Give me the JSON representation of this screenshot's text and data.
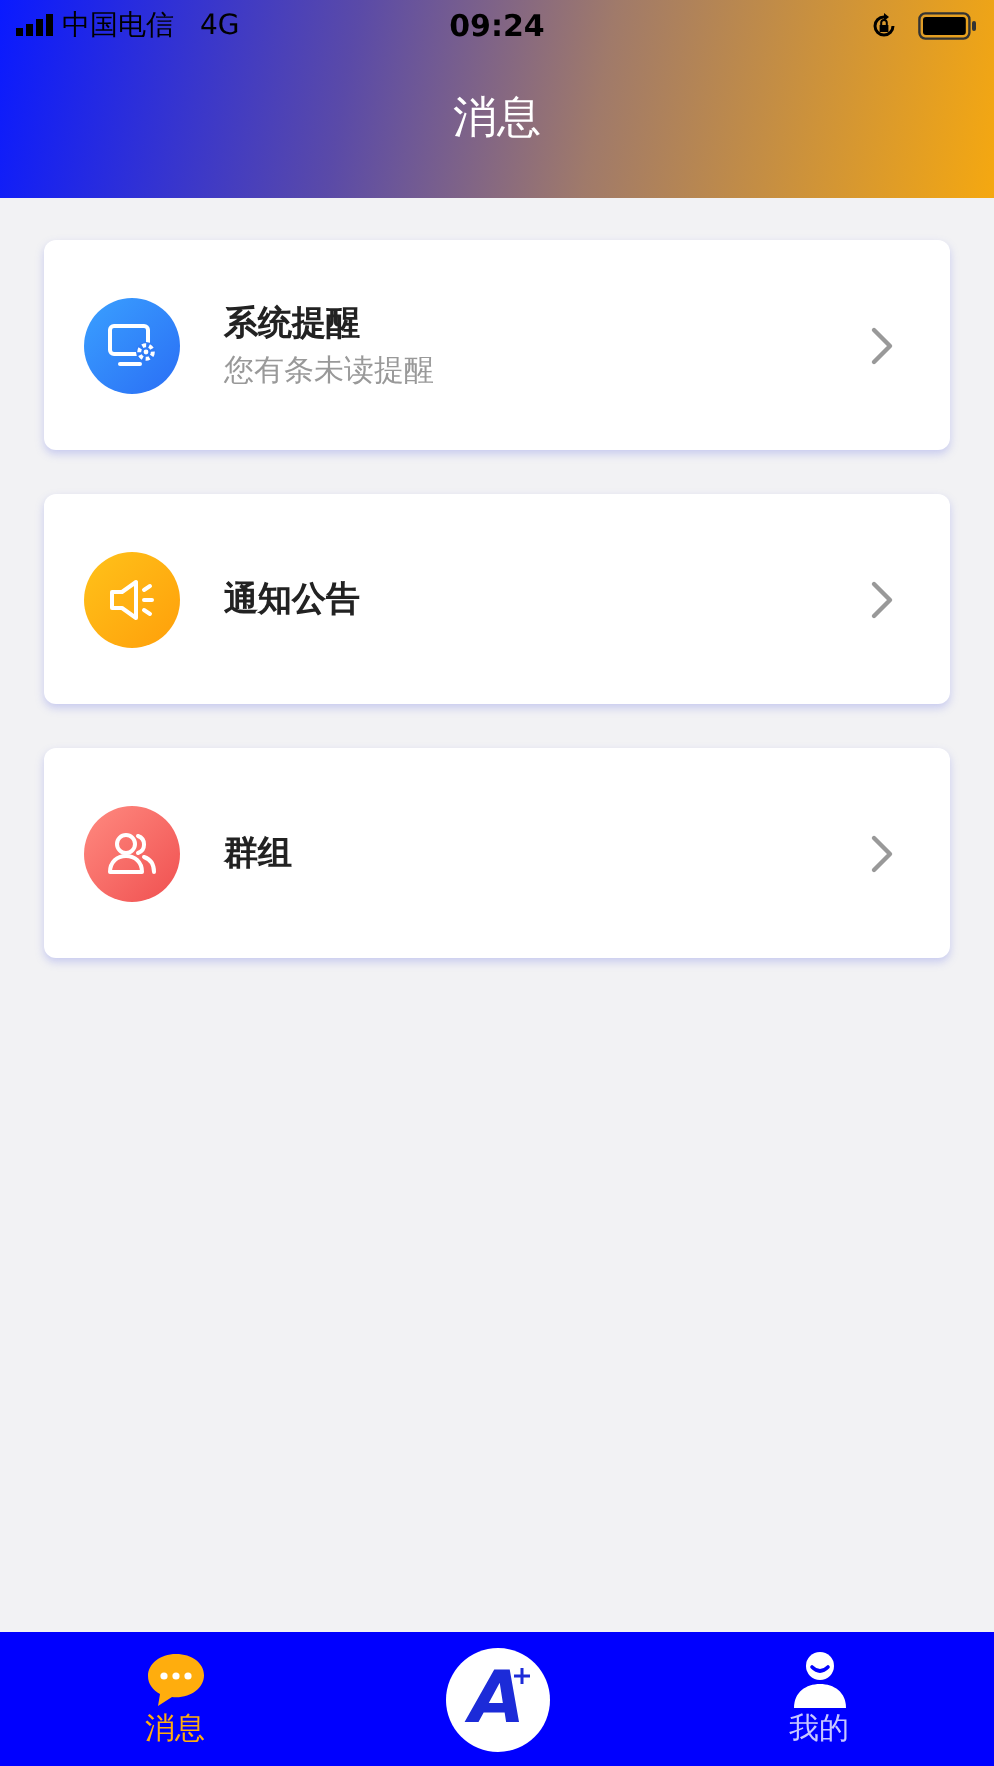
{
  "status_bar": {
    "carrier": "中国电信",
    "network": "4G",
    "time": "09:24"
  },
  "header": {
    "title": "消息"
  },
  "items": [
    {
      "kind": "system",
      "title": "系统提醒",
      "subtitle": "您有条未读提醒"
    },
    {
      "kind": "notice",
      "title": "通知公告"
    },
    {
      "kind": "group",
      "title": "群组"
    }
  ],
  "tabs": [
    {
      "kind": "chat",
      "label": "消息",
      "selected": true
    },
    {
      "kind": "logo",
      "logo_text": "A",
      "selected": false
    },
    {
      "kind": "user",
      "label": "我的",
      "selected": false
    }
  ]
}
